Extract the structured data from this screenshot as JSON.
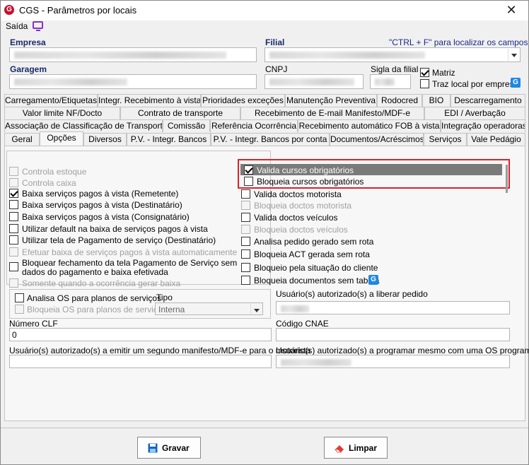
{
  "window": {
    "title": "CGS - Parâmetros por locais",
    "close": "✕"
  },
  "menu": {
    "saida": "Saída"
  },
  "header": {
    "empresa_label": "Empresa",
    "filial_label": "Filial",
    "ctrl_hint": "\"CTRL + F\" para localizar os campos",
    "garagem_label": "Garagem",
    "cnpj_label": "CNPJ",
    "sigla_label": "Sigla da filial",
    "matriz_label": "Matriz",
    "matriz_checked": true,
    "traz_local_label": "Traz local por empresa",
    "traz_local_checked": false
  },
  "tabs": {
    "row1": [
      "Carregamento/Etiquetas",
      "Integr. Recebimento à vista",
      "Prioridades exceções",
      "Manutenção Preventiva",
      "Rodocred",
      "BIO",
      "Descarregamento"
    ],
    "row2": [
      "Valor limite NF/Docto",
      "Contrato de transporte",
      "Recebimento de E-mail Manifesto/MDF-e",
      "EDI / Averbação"
    ],
    "row3": [
      "Associação de Classificação de Transporte",
      "Comissão",
      "Referência Ocorrência",
      "Recebimento automático FOB à vista",
      "Integração operadoras"
    ],
    "row4": [
      "Geral",
      "Opções",
      "Diversos",
      "P.V. - Integr. Bancos",
      "P.V. - Integr. Bancos por conta",
      "Documentos/Acréscimos",
      "Serviços",
      "Vale Pedágio"
    ],
    "active": "Opções"
  },
  "options_left": [
    {
      "label": "Controla estoque",
      "checked": false,
      "enabled": false
    },
    {
      "label": "Controla caixa",
      "checked": false,
      "enabled": false
    },
    {
      "label": "Baixa serviços pagos à vista (Remetente)",
      "checked": true,
      "enabled": true
    },
    {
      "label": "Baixa serviços pagos à vista (Destinatário)",
      "checked": false,
      "enabled": true
    },
    {
      "label": "Baixa serviços pagos à vista (Consignatário)",
      "checked": false,
      "enabled": true
    },
    {
      "label": "Utilizar default na baixa de serviços pagos à vista",
      "checked": false,
      "enabled": true
    },
    {
      "label": "Utilizar tela de Pagamento de serviço (Destinatário)",
      "checked": false,
      "enabled": true
    },
    {
      "label": "Efetuar baixa de serviços pagos à vista automaticamente",
      "checked": false,
      "enabled": false
    },
    {
      "label": "Bloquear fechamento da tela Pagamento de Serviço sem",
      "label2": "dados do pagamento e baixa efetivada",
      "checked": false,
      "enabled": true
    },
    {
      "label": "Somente quando a ocorrência gerar baixa",
      "checked": false,
      "enabled": false
    }
  ],
  "options_right": [
    {
      "label": "Valida cursos obrigatórios",
      "checked": true,
      "enabled": true
    },
    {
      "label": "Bloqueia cursos obrigatórios",
      "checked": false,
      "enabled": true
    },
    {
      "label": "Valida doctos motorista",
      "checked": false,
      "enabled": true
    },
    {
      "label": "Bloqueia doctos motorista",
      "checked": false,
      "enabled": false
    },
    {
      "label": "Valida doctos veículos",
      "checked": false,
      "enabled": true
    },
    {
      "label": "Bloqueia doctos veículos",
      "checked": false,
      "enabled": false
    },
    {
      "label": "Analisa pedido gerado sem rota",
      "checked": false,
      "enabled": true
    },
    {
      "label": "Bloqueia ACT gerada sem rota",
      "checked": false,
      "enabled": true
    },
    {
      "label": "Bloqueio pela situação do cliente",
      "checked": false,
      "enabled": true
    },
    {
      "label": "Bloqueia documentos sem tabela",
      "checked": false,
      "enabled": true
    }
  ],
  "os_group": {
    "analisa_label": "Analisa OS para planos de serviços",
    "bloqueia_label": "Bloqueia OS para planos de serviços",
    "tipo_label": "Tipo",
    "tipo_value": "Interna"
  },
  "fields": {
    "usuarios_liberar_label": "Usuário(s) autorizado(s) a liberar pedido",
    "numero_clf_label": "Número CLF",
    "numero_clf_value": "0",
    "codigo_cnae_label": "Código CNAE",
    "segundo_manifesto_label": "Usuário(s) autorizado(s) a emitir um segundo manifesto/MDF-e para o motorista",
    "programar_os_label": "Usuário(s) autorizado(s) a programar mesmo com uma OS programada"
  },
  "buttons": {
    "gravar": "Gravar",
    "limpar": "Limpar"
  },
  "colors": {
    "highlight_border": "#e0202a",
    "selected_row": "#7a7a7a",
    "brand": "#c8102e",
    "accent_blue": "#1e88e5"
  }
}
